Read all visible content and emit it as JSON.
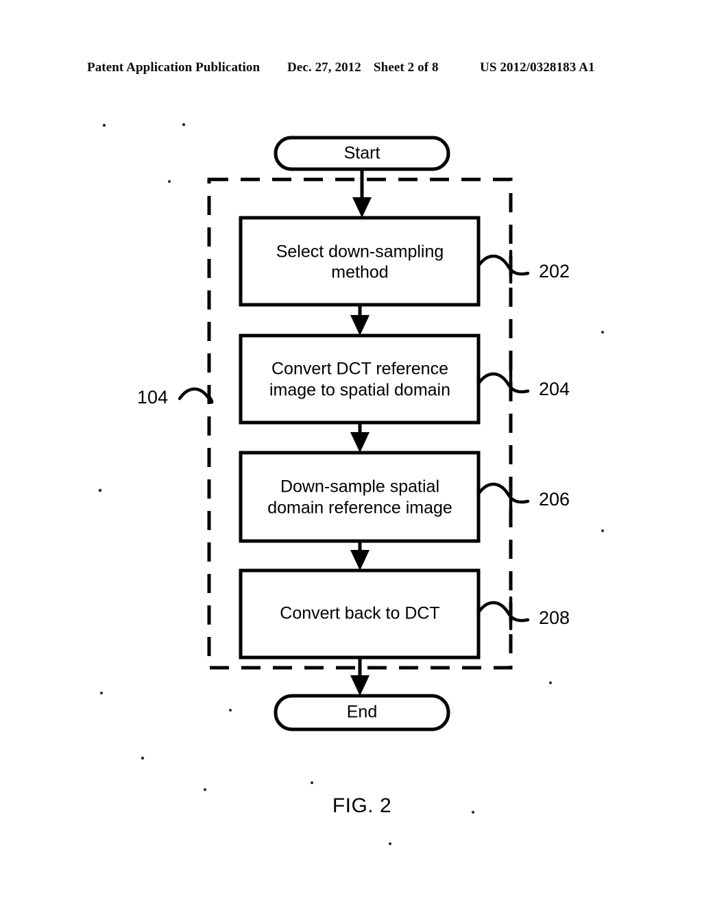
{
  "header": {
    "publication": "Patent Application Publication",
    "date": "Dec. 27, 2012",
    "sheet": "Sheet 2 of 8",
    "patent_number": "US 2012/0328183 A1"
  },
  "figure": {
    "caption": "FIG. 2",
    "group_ref": "104",
    "start_label": "Start",
    "end_label": "End",
    "steps": [
      {
        "ref": "202",
        "line1": "Select down-sampling",
        "line2": "method"
      },
      {
        "ref": "204",
        "line1": "Convert DCT reference",
        "line2": "image to spatial domain"
      },
      {
        "ref": "206",
        "line1": "Down-sample spatial",
        "line2": "domain reference image"
      },
      {
        "ref": "208",
        "line1": "Convert back to DCT",
        "line2": ""
      }
    ]
  },
  "colors": {
    "ink": "#000000",
    "page": "#ffffff"
  }
}
